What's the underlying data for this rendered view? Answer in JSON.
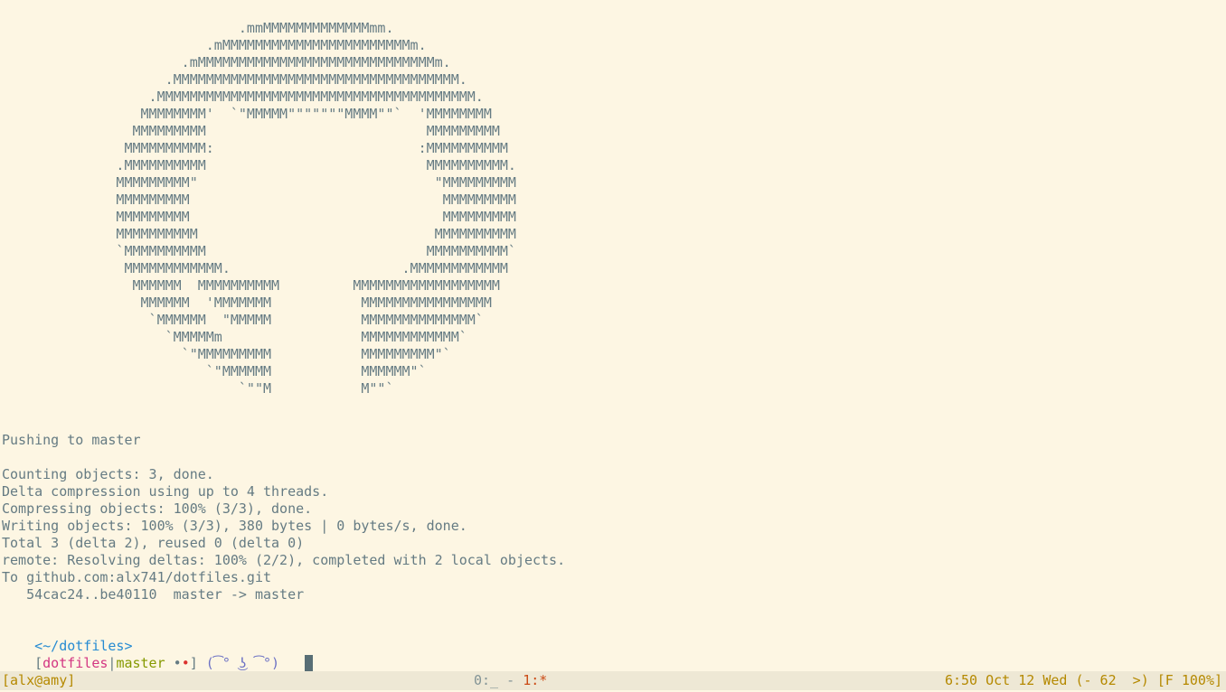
{
  "art_lines": [
    "                             .mmMMMMMMMMMMMMMmm.",
    "                         .mMMMMMMMMMMMMMMMMMMMMMMMm.",
    "                      .mMMMMMMMMMMMMMMMMMMMMMMMMMMMMMm.",
    "                    .MMMMMMMMMMMMMMMMMMMMMMMMMMMMMMMMMMM.",
    "                  .MMMMMMMMMMMMMMMMMMMMMMMMMMMMMMMMMMMMMMM.",
    "                 MMMMMMMM'  `\"MMMMM\"\"\"\"\"\"\"MMMM\"\"`  'MMMMMMMM",
    "                MMMMMMMMM                           MMMMMMMMM",
    "               MMMMMMMMMM:                         :MMMMMMMMMM",
    "              .MMMMMMMMMM                           MMMMMMMMMM.",
    "              MMMMMMMMM\"                             \"MMMMMMMMM",
    "              MMMMMMMMM                               MMMMMMMMM",
    "              MMMMMMMMM                               MMMMMMMMM",
    "              MMMMMMMMMM                             MMMMMMMMMM",
    "              `MMMMMMMMMM                           MMMMMMMMMM`",
    "               MMMMMMMMMMMM.                     .MMMMMMMMMMMM",
    "                MMMMMM  MMMMMMMMMM         MMMMMMMMMMMMMMMMMM",
    "                 MMMMMM  'MMMMMMM           MMMMMMMMMMMMMMMM",
    "                  `MMMMMM  \"MMMMM           MMMMMMMMMMMMMM`",
    "                    `MMMMMm                 MMMMMMMMMMMM`",
    "                      `\"MMMMMMMMM           MMMMMMMMM\"`",
    "                         `\"MMMMMM           MMMMMM\"`",
    "                             `\"\"M           M\"\"`"
  ],
  "output_lines": [
    "Pushing to master",
    "",
    "Counting objects: 3, done.",
    "Delta compression using up to 4 threads.",
    "Compressing objects: 100% (3/3), done.",
    "Writing objects: 100% (3/3), 380 bytes | 0 bytes/s, done.",
    "Total 3 (delta 2), reused 0 (delta 0)",
    "remote: Resolving deltas: 100% (2/2), completed with 2 local objects.",
    "To github.com:alx741/dotfiles.git",
    "   54cac24..be40110  master -> master"
  ],
  "prompt": {
    "path": "<~/dotfiles>",
    "open_bracket": "[",
    "repo": "dotfiles",
    "separator": "|",
    "branch": "master",
    "dot_a": "•",
    "dot_b": "•",
    "close_bracket": "]",
    "face": "(͡° ͜ʖ ͡°)"
  },
  "statusbar": {
    "session": "[alx@amy]",
    "window_0": "0:_ - ",
    "window_1": "1:*",
    "clock": "6:50 Oct 12 Wed (- 62  >) [F 100%]"
  },
  "colors": {
    "background": "#fdf6e3",
    "foreground": "#657b83",
    "path": "#268bd2",
    "repo": "#d33682",
    "branch": "#859900",
    "dirty_dot": "#dc322f",
    "face": "#6c71c4",
    "statusbar_bg": "#eee8d5",
    "statusbar_fg": "#b58900",
    "active_window": "#cb4b16"
  }
}
